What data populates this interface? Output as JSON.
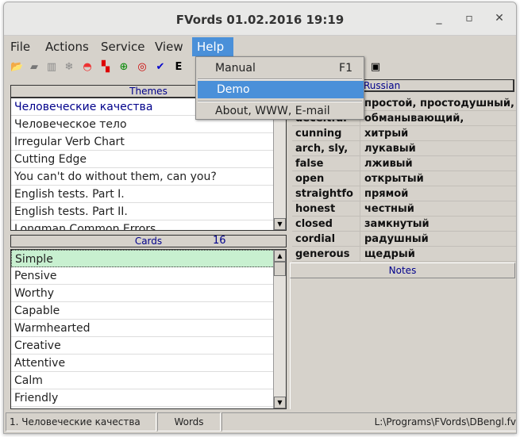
{
  "window": {
    "title": "FVords  01.02.2016  19:19",
    "minimize": "_",
    "maximize": "▫",
    "close": "✕"
  },
  "menubar": [
    {
      "label": "File"
    },
    {
      "label": "Actions"
    },
    {
      "label": "Service"
    },
    {
      "label": "View"
    },
    {
      "label": "Help"
    }
  ],
  "help_menu": {
    "items": [
      {
        "label": "Manual",
        "shortcut": "F1"
      },
      {
        "label": "Demo"
      },
      {
        "label": "About, WWW, E-mail"
      }
    ]
  },
  "toolbar": [
    "open-folder-icon",
    "folder-icon",
    "book-icon",
    "snowflake-icon",
    "rainbow-icon",
    "cards-icon",
    "target-green-icon",
    "target-icon",
    "spellcheck-icon",
    "ex-icon",
    "save-icon"
  ],
  "themes": {
    "header": "Themes",
    "items": [
      "Человеческие качества",
      "Человеческое тело",
      "Irregular Verb Chart",
      "Cutting Edge",
      "You can't do without them, can you?",
      "English tests. Part I.",
      "English tests. Part II.",
      "Longman Common Errors"
    ]
  },
  "cards": {
    "header": "Cards",
    "count": "16",
    "items": [
      "Simple",
      "Pensive",
      "Worthy",
      "Capable",
      "Warmhearted",
      "Creative",
      "Attentive",
      "Calm",
      "Friendly"
    ]
  },
  "words": {
    "header_russian": "Russian",
    "rows": [
      [
        "",
        "простой, простодушный,"
      ],
      [
        "deceitful",
        "обманывающий,"
      ],
      [
        "cunning",
        "хитрый"
      ],
      [
        "arch, sly,",
        "лукавый"
      ],
      [
        "false",
        "лживый"
      ],
      [
        "open",
        "открытый"
      ],
      [
        "straightfo",
        "прямой"
      ],
      [
        "honest",
        "честный"
      ],
      [
        "closed",
        "замкнутый"
      ],
      [
        "cordial",
        "радушный"
      ],
      [
        "generous",
        "щедрый"
      ]
    ]
  },
  "notes": {
    "header": "Notes"
  },
  "status": {
    "theme": "1. Человеческие качества",
    "mode": "Words",
    "path": "L:\\Programs\\FVords\\DBengl.fv"
  },
  "colors": {
    "menu_highlight": "#4a90d9",
    "selected_card": "#c8f0d0",
    "header_text": "#00008b"
  }
}
